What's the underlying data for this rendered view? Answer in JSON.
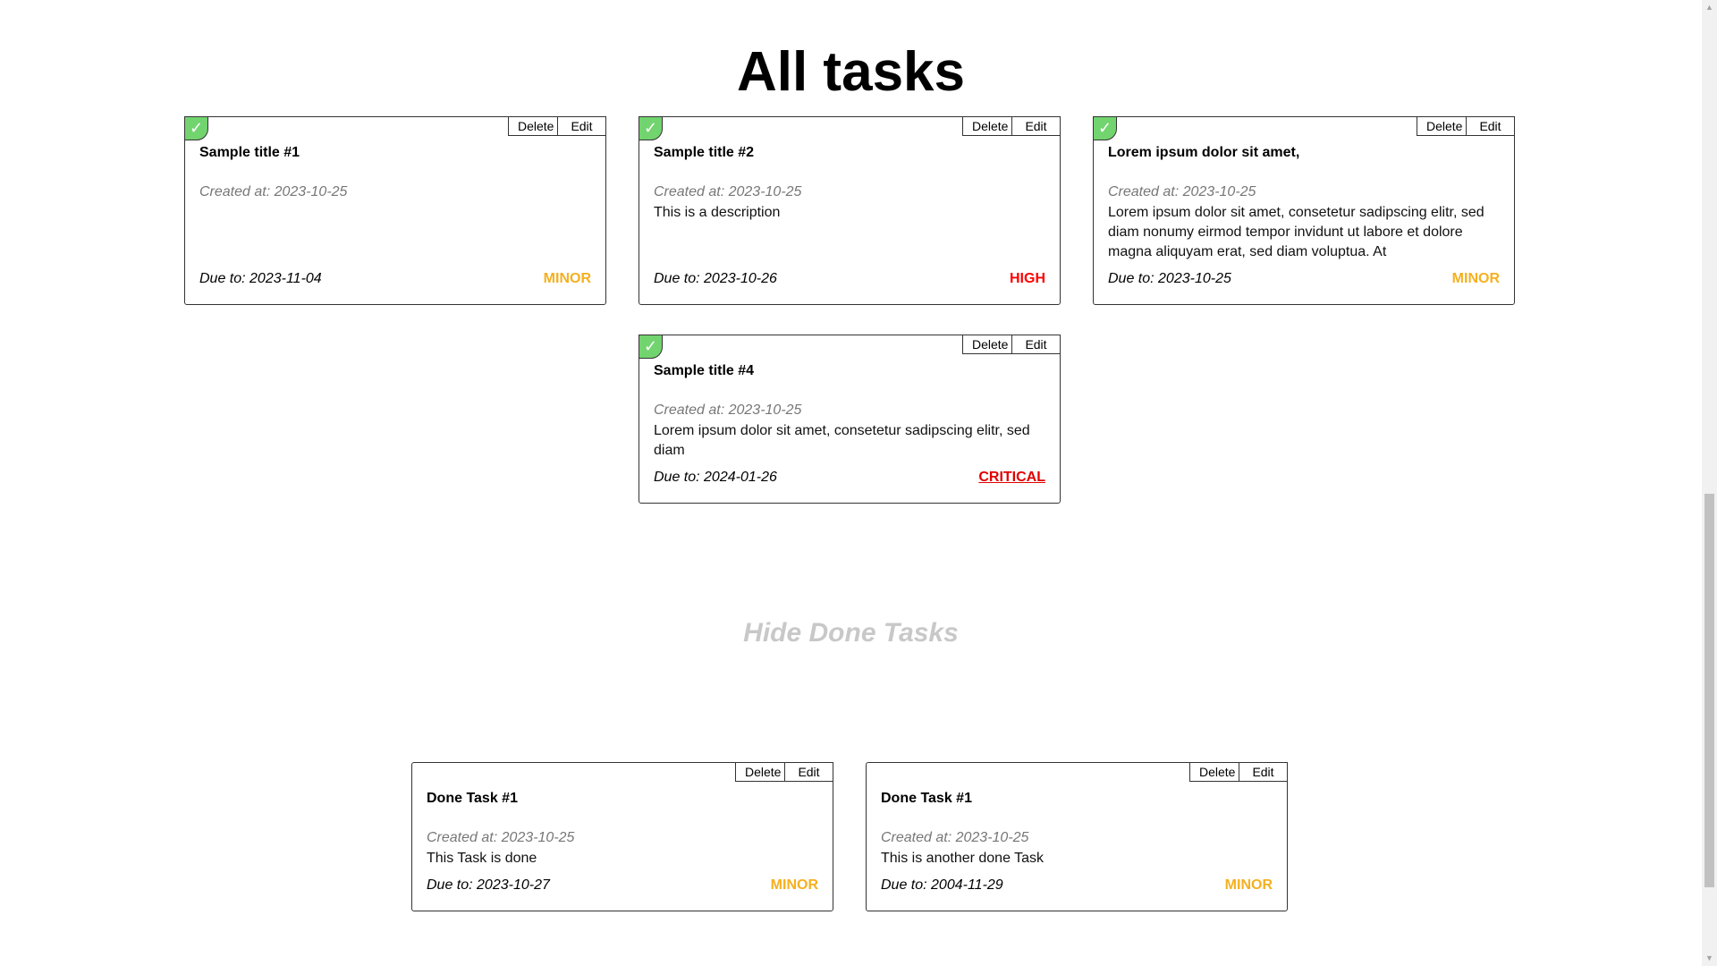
{
  "page": {
    "title": "All tasks",
    "toggle_label": "Hide Done Tasks"
  },
  "labels": {
    "delete": "Delete",
    "edit": "Edit",
    "check": "✓"
  },
  "tasks": [
    {
      "title": "Sample title #1",
      "created": "Created at: 2023-10-25",
      "description": "",
      "due": "Due to: 2023-11-04",
      "priority": "MINOR"
    },
    {
      "title": "Sample title #2",
      "created": "Created at: 2023-10-25",
      "description": "This is a description",
      "due": "Due to: 2023-10-26",
      "priority": "HIGH"
    },
    {
      "title": "Lorem ipsum dolor sit amet,",
      "created": "Created at: 2023-10-25",
      "description": "Lorem ipsum dolor sit amet, consetetur sadipscing elitr, sed diam nonumy eirmod tempor invidunt ut labore et dolore magna aliquyam erat, sed diam voluptua. At",
      "due": "Due to: 2023-10-25",
      "priority": "MINOR"
    },
    {
      "title": "Sample title #4",
      "created": "Created at: 2023-10-25",
      "description": "Lorem ipsum dolor sit amet, consetetur sadipscing elitr, sed diam",
      "due": "Due to: 2024-01-26",
      "priority": "CRITICAL"
    }
  ],
  "done_tasks": [
    {
      "title": "Done Task #1",
      "created": "Created at: 2023-10-25",
      "description": "This Task is done",
      "due": "Due to: 2023-10-27",
      "priority": "MINOR"
    },
    {
      "title": "Done Task #1",
      "created": "Created at: 2023-10-25",
      "description": "This is another done Task",
      "due": "Due to: 2004-11-29",
      "priority": "MINOR"
    }
  ],
  "colors": {
    "minor": "#f5b020",
    "high": "#ff0000",
    "critical": "#e00000",
    "check": "#72d46e",
    "toggle": "#c8c8c8"
  },
  "icons": {
    "check": "check-icon"
  }
}
